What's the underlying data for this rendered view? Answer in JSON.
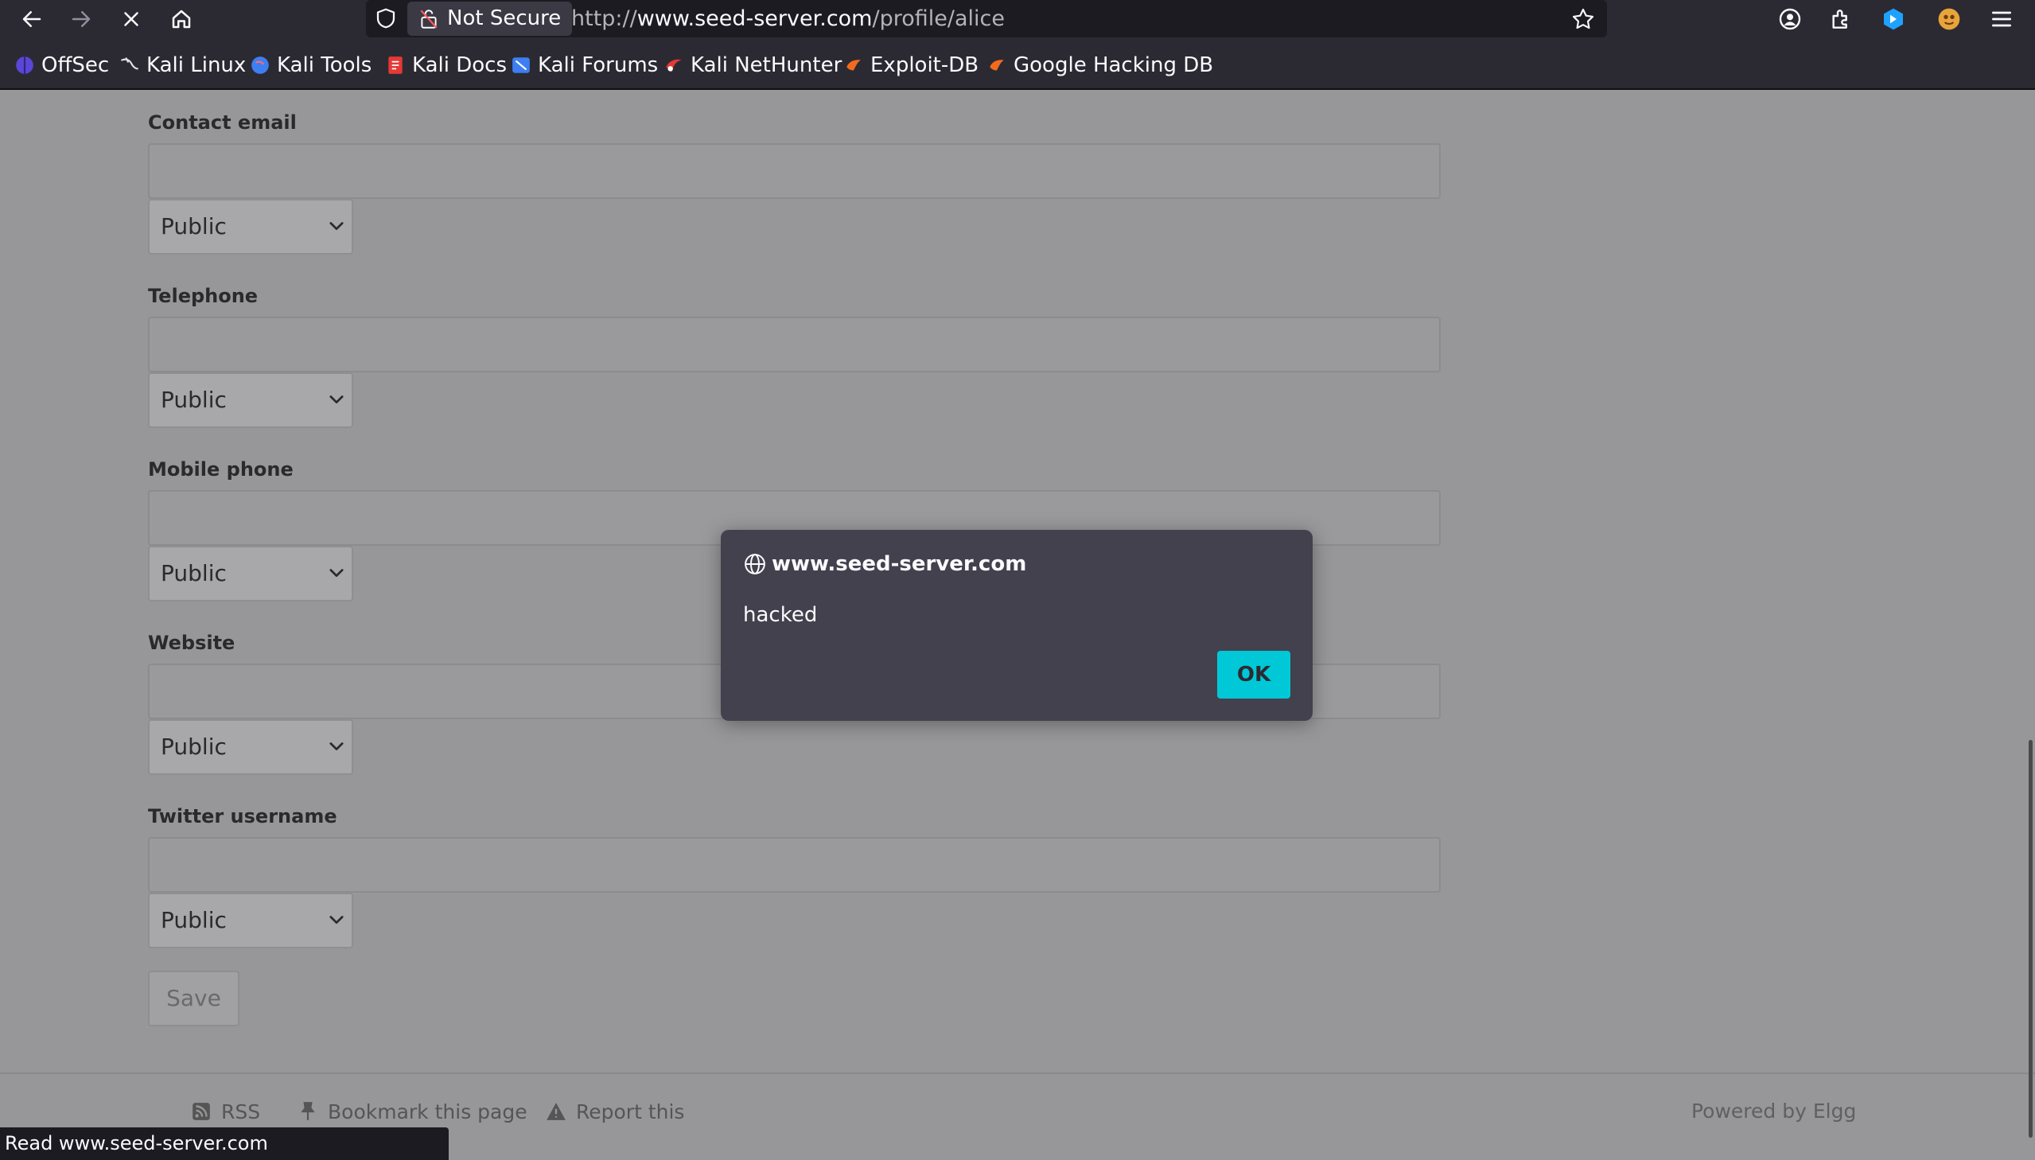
{
  "browser": {
    "security_label": "Not Secure",
    "url_scheme": "http://",
    "url_host": "www.seed-server.com",
    "url_path": "/profile/alice",
    "bookmarks": [
      {
        "label": "OffSec",
        "icon": "offsec-icon",
        "color": "#6a4fe0"
      },
      {
        "label": "Kali Linux",
        "icon": "kali-dragon-icon",
        "color": "#e0e0e0"
      },
      {
        "label": "Kali Tools",
        "icon": "kali-tools-icon",
        "color": "#3d7ff2"
      },
      {
        "label": "Kali Docs",
        "icon": "kali-docs-icon",
        "color": "#e53935"
      },
      {
        "label": "Kali Forums",
        "icon": "kali-forums-icon",
        "color": "#3d7ff2"
      },
      {
        "label": "Kali NetHunter",
        "icon": "nethunter-icon",
        "color": "#e53935"
      },
      {
        "label": "Exploit-DB",
        "icon": "exploit-db-icon",
        "color": "#f26b1d"
      },
      {
        "label": "Google Hacking DB",
        "icon": "ghdb-icon",
        "color": "#f26b1d"
      }
    ]
  },
  "form": {
    "fields": [
      {
        "label": "Contact email",
        "value": "",
        "access": "Public"
      },
      {
        "label": "Telephone",
        "value": "",
        "access": "Public"
      },
      {
        "label": "Mobile phone",
        "value": "",
        "access": "Public"
      },
      {
        "label": "Website",
        "value": "",
        "access": "Public"
      },
      {
        "label": "Twitter username",
        "value": "",
        "access": "Public"
      }
    ],
    "save_label": "Save"
  },
  "footer": {
    "rss_label": "RSS",
    "bookmark_label": "Bookmark this page",
    "report_label": "Report this",
    "powered_by": "Powered by Elgg"
  },
  "status_bar": {
    "text": "Read www.seed-server.com"
  },
  "dialog": {
    "origin": "www.seed-server.com",
    "message": "hacked",
    "ok_label": "OK",
    "accent_color": "#00c8d7"
  }
}
